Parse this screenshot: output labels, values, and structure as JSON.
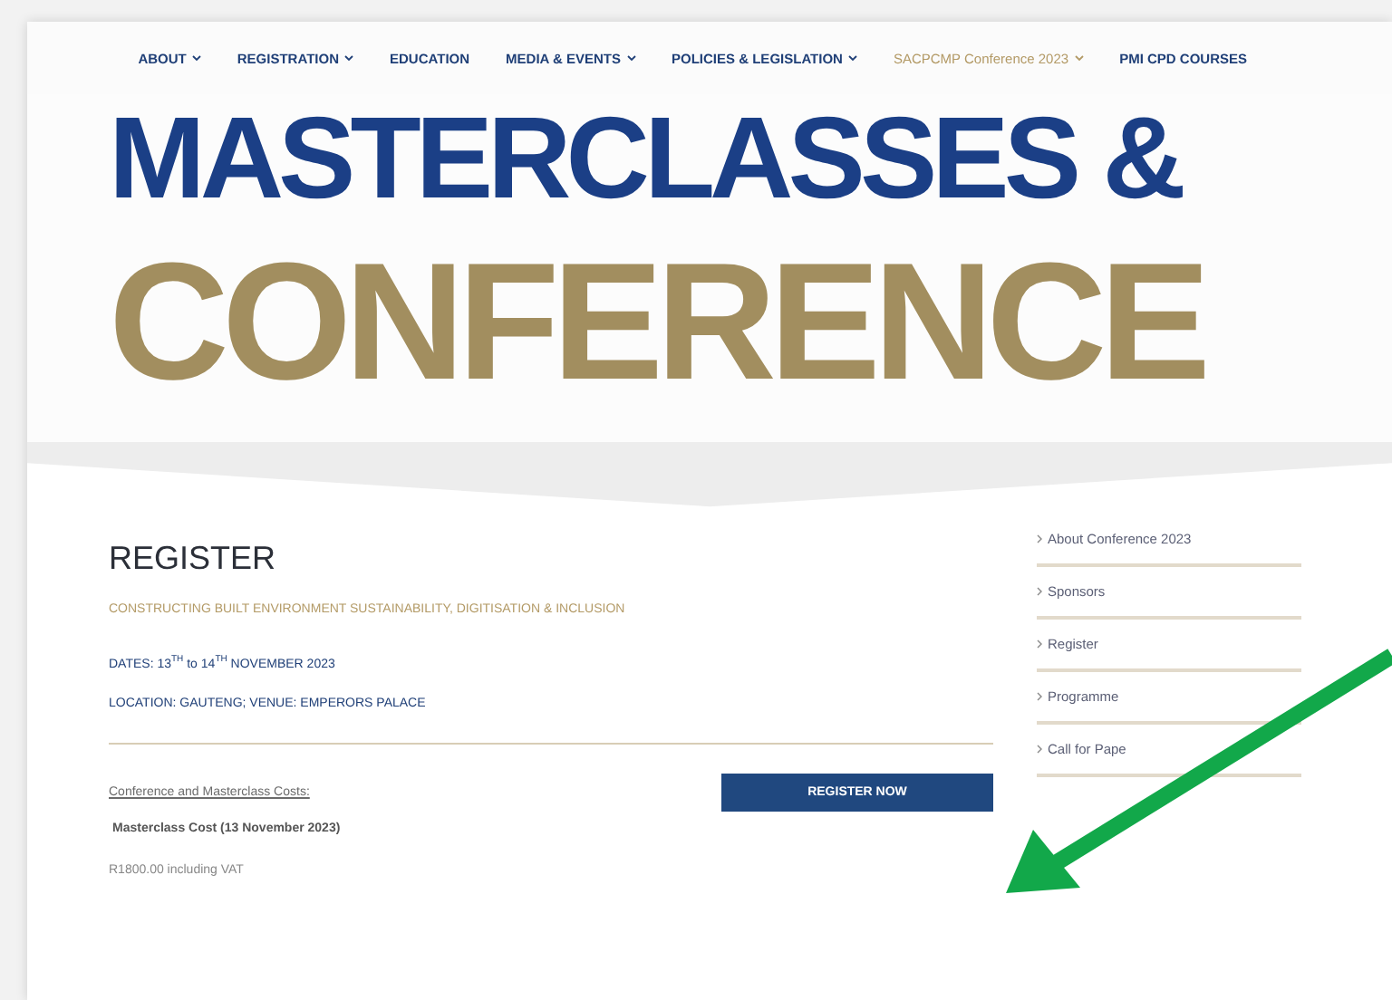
{
  "nav": [
    {
      "label": "ABOUT",
      "dropdown": true,
      "selected": false
    },
    {
      "label": "REGISTRATION",
      "dropdown": true,
      "selected": false
    },
    {
      "label": "EDUCATION",
      "dropdown": false,
      "selected": false
    },
    {
      "label": "MEDIA & EVENTS",
      "dropdown": true,
      "selected": false
    },
    {
      "label": "POLICIES & LEGISLATION",
      "dropdown": true,
      "selected": false
    },
    {
      "label": "SACPCMP Conference 2023",
      "dropdown": true,
      "selected": true
    },
    {
      "label": "PMI CPD COURSES",
      "dropdown": false,
      "selected": false
    }
  ],
  "hero": {
    "line_1": "MASTERCLASSES &",
    "line_2": "CONFERENCE"
  },
  "content": {
    "title": "REGISTER",
    "subtitle": "CONSTRUCTING BUILT ENVIRONMENT SUSTAINABILITY, DIGITISATION & INCLUSION",
    "dates": "DATES: 13$^{TH}$ to 14$^{TH}$ NOVEMBER 2023",
    "location": "LOCATION: GAUTENG; VENUE: EMPERORS PALACE",
    "costs_link": "Conference and Masterclass Costs:",
    "register_button": "REGISTER NOW",
    "cost_heading": "Masterclass Cost (13 November 2023)",
    "cost_value": "R1800.00 including VAT"
  },
  "sidebar": {
    "items": [
      {
        "label": "About Conference 2023"
      },
      {
        "label": "Sponsors"
      },
      {
        "label": "Register"
      },
      {
        "label": "Programme"
      },
      {
        "label": "Call for Pape"
      }
    ]
  }
}
